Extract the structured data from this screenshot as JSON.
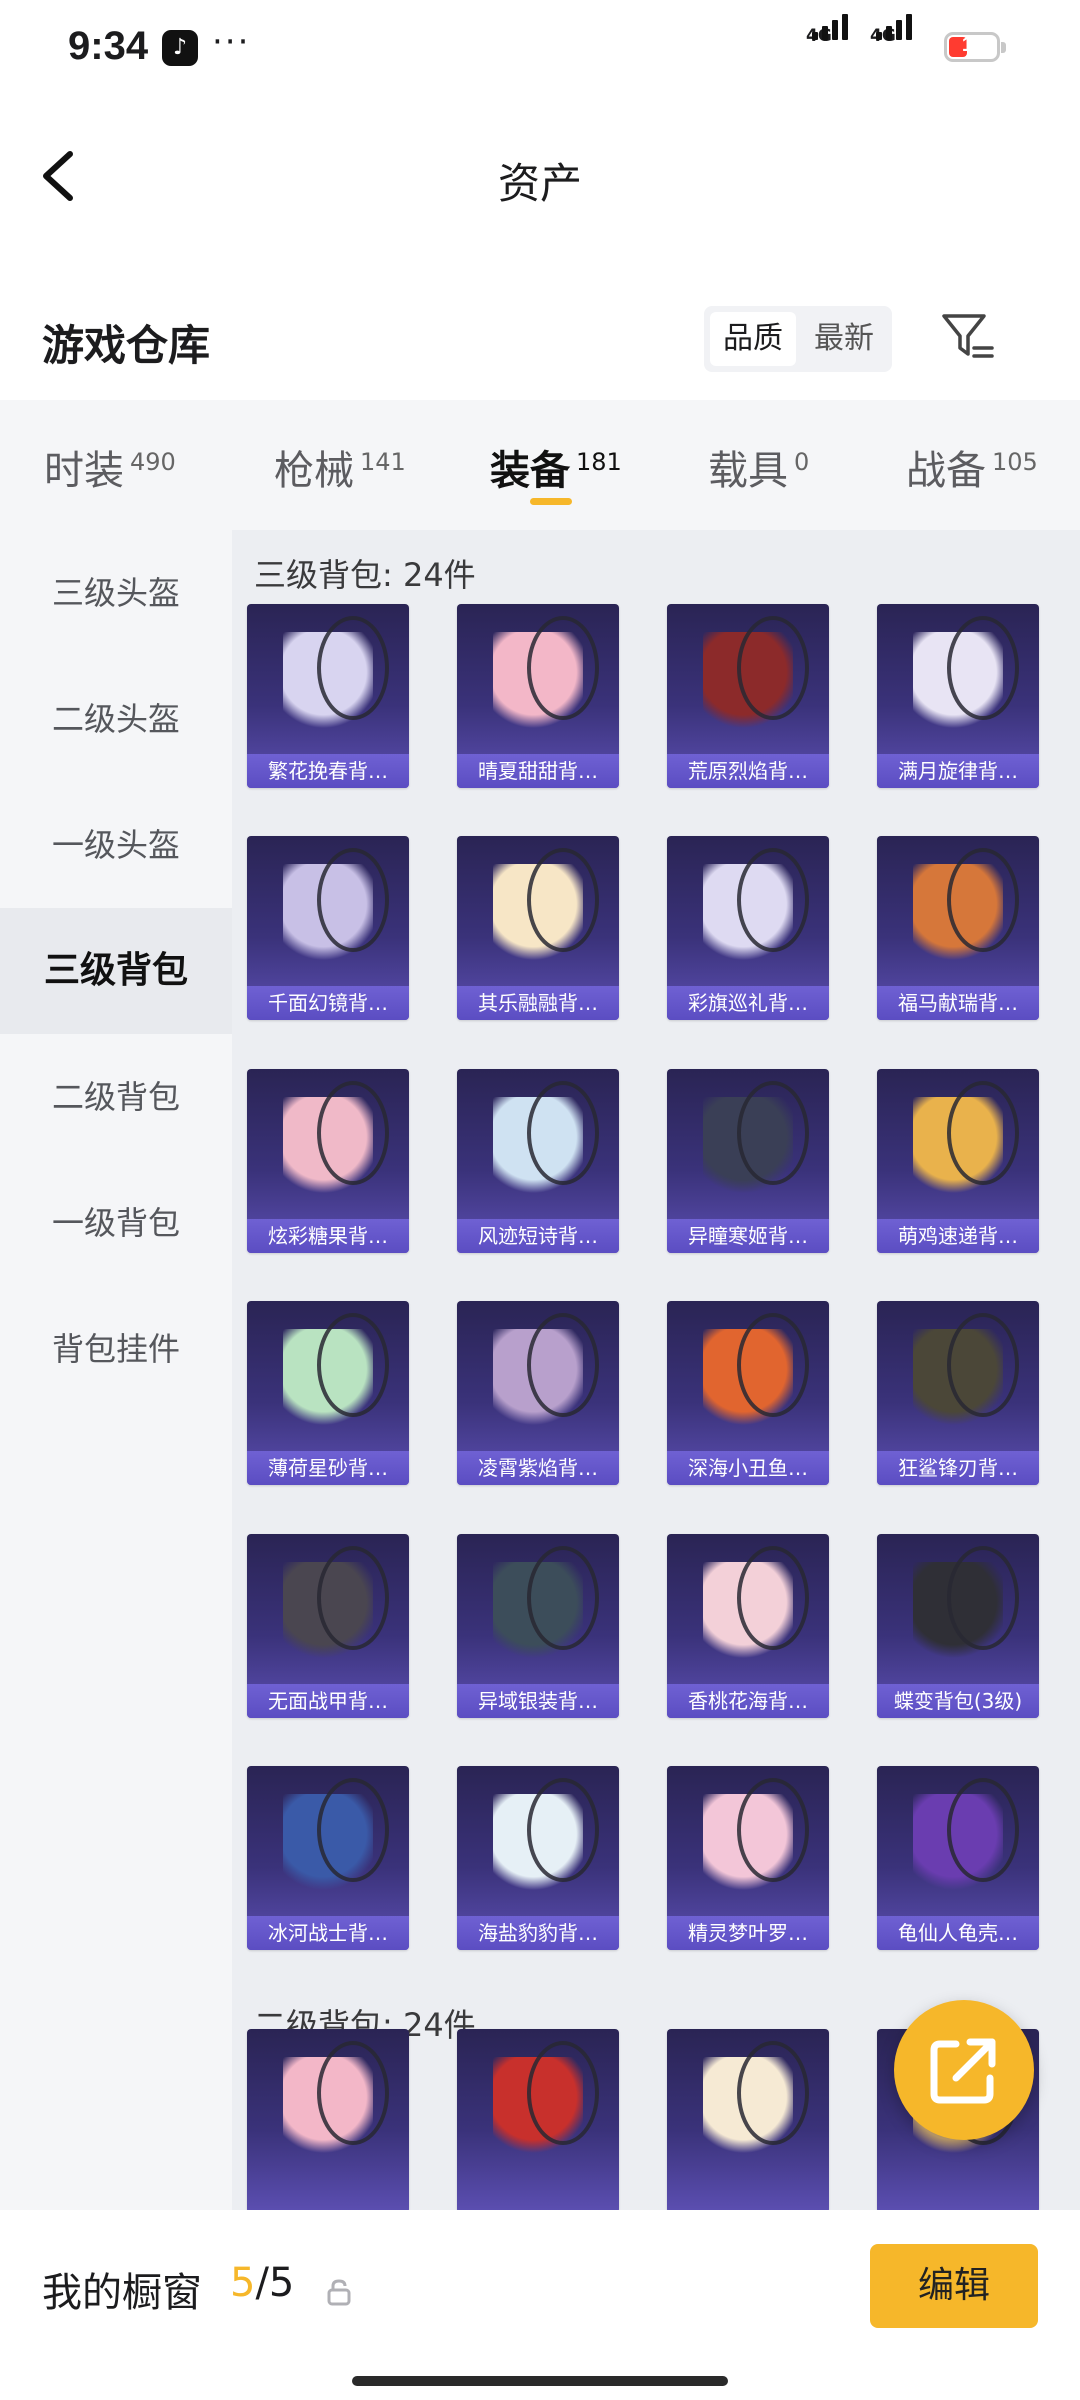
{
  "status_bar": {
    "time": "9:34",
    "app_badge": "♪",
    "more": "···",
    "signal_1_label": "4G",
    "signal_2_label": "4G",
    "battery": "18",
    "battery_color": "#ff3b30"
  },
  "nav": {
    "title": "资产",
    "back_icon": "chevron-left-icon"
  },
  "warehouse": {
    "title": "游戏仓库",
    "sort_active": "品质",
    "sort_other": "最新",
    "filter_icon": "filter-icon"
  },
  "tabs": [
    {
      "label": "时装",
      "count": "490",
      "active": false
    },
    {
      "label": "枪械",
      "count": "141",
      "active": false
    },
    {
      "label": "装备",
      "count": "181",
      "active": true
    },
    {
      "label": "载具",
      "count": "0",
      "active": false
    },
    {
      "label": "战备",
      "count": "105",
      "active": false
    }
  ],
  "sidebar": {
    "items": [
      {
        "label": "三级头盔",
        "active": false
      },
      {
        "label": "二级头盔",
        "active": false
      },
      {
        "label": "一级头盔",
        "active": false
      },
      {
        "label": "三级背包",
        "active": true
      },
      {
        "label": "二级背包",
        "active": false
      },
      {
        "label": "一级背包",
        "active": false
      },
      {
        "label": "背包挂件",
        "active": false
      }
    ]
  },
  "sections": [
    {
      "title": "三级背包: 24件",
      "items": [
        {
          "name": "繁花挽春背…",
          "color": "#d8d4f0"
        },
        {
          "name": "晴夏甜甜背…",
          "color": "#f3b7c8"
        },
        {
          "name": "荒原烈焰背…",
          "color": "#8c2a2a"
        },
        {
          "name": "满月旋律背…",
          "color": "#e8e4f4"
        },
        {
          "name": "千面幻镜背…",
          "color": "#c8c0e6"
        },
        {
          "name": "其乐融融背…",
          "color": "#f7e6c6"
        },
        {
          "name": "彩旗巡礼背…",
          "color": "#dedaf2"
        },
        {
          "name": "福马献瑞背…",
          "color": "#d6773a"
        },
        {
          "name": "炫彩糖果背…",
          "color": "#f0b9c8"
        },
        {
          "name": "风迹短诗背…",
          "color": "#cfe2f2"
        },
        {
          "name": "异瞳寒姬背…",
          "color": "#3a3f56"
        },
        {
          "name": "萌鸡速递背…",
          "color": "#e9b24c"
        },
        {
          "name": "薄荷星砂背…",
          "color": "#b9e3c1"
        },
        {
          "name": "凌霄紫焰背…",
          "color": "#b8a0cc"
        },
        {
          "name": "深海小丑鱼…",
          "color": "#e1652f"
        },
        {
          "name": "狂鲨锋刃背…",
          "color": "#4b4738"
        },
        {
          "name": "无面战甲背…",
          "color": "#4a4650"
        },
        {
          "name": "异域银装背…",
          "color": "#3c4d5a"
        },
        {
          "name": "香桃花海背…",
          "color": "#f3d0d8"
        },
        {
          "name": "蝶变背包(3级)",
          "color": "#2f2f36"
        },
        {
          "name": "冰河战士背…",
          "color": "#3a5aa8"
        },
        {
          "name": "海盐豹豹背…",
          "color": "#e6f0f6"
        },
        {
          "name": "精灵梦叶罗…",
          "color": "#f3c6d8"
        },
        {
          "name": "龟仙人龟壳…",
          "color": "#6a3db0"
        }
      ]
    },
    {
      "title": "二级背包: 24件",
      "items": [
        {
          "name": "",
          "color": "#f3b7c8"
        },
        {
          "name": "",
          "color": "#c8302c"
        },
        {
          "name": "",
          "color": "#f6ead4"
        },
        {
          "name": "",
          "color": "#d8b27a"
        }
      ]
    }
  ],
  "fab": {
    "icon": "share-external-icon"
  },
  "bottom_bar": {
    "label": "我的橱窗",
    "count_current": "5",
    "count_total": "/5",
    "edit_label": "编辑",
    "accent": "#f6b72a"
  }
}
